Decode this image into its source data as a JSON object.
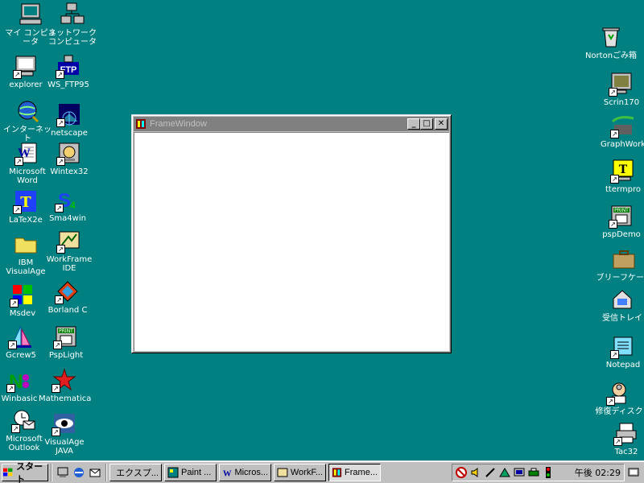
{
  "desktop": {
    "icons_left": [
      {
        "id": "my-computer",
        "label": "マイ コンピュータ",
        "icon": "computer-icon"
      },
      {
        "id": "network",
        "label": "ネットワーク\nコンピュータ",
        "icon": "network-icon"
      },
      {
        "id": "explorer",
        "label": "explorer",
        "icon": "explorer-icon"
      },
      {
        "id": "ws-ftp95",
        "label": "WS_FTP95",
        "icon": "ftp-icon"
      },
      {
        "id": "internet",
        "label": "インターネット",
        "icon": "internet-icon"
      },
      {
        "id": "netscape",
        "label": "netscape",
        "icon": "netscape-icon"
      },
      {
        "id": "word",
        "label": "Microsoft\nWord",
        "icon": "word-icon"
      },
      {
        "id": "wintex32",
        "label": "Wintex32",
        "icon": "wintex-icon"
      },
      {
        "id": "latex2e",
        "label": "LaTeX2e",
        "icon": "latex-icon"
      },
      {
        "id": "sma4win",
        "label": "Sma4win",
        "icon": "sma-icon"
      },
      {
        "id": "visualage",
        "label": "IBM\nVisualAge",
        "icon": "folder-icon"
      },
      {
        "id": "workframe",
        "label": "WorkFrame\nIDE",
        "icon": "workframe-icon"
      },
      {
        "id": "msdev",
        "label": "Msdev",
        "icon": "msdev-icon"
      },
      {
        "id": "borland",
        "label": "Borland C",
        "icon": "borland-icon"
      },
      {
        "id": "gcrew5",
        "label": "Gcrew5",
        "icon": "gcrew-icon"
      },
      {
        "id": "psplight",
        "label": "PspLight",
        "icon": "psp-icon"
      },
      {
        "id": "winbasic",
        "label": "Winbasic",
        "icon": "winbasic-icon"
      },
      {
        "id": "mathematica",
        "label": "Mathematica",
        "icon": "mathematica-icon"
      },
      {
        "id": "outlook",
        "label": "Microsoft\nOutlook",
        "icon": "outlook-icon"
      },
      {
        "id": "visualage-java",
        "label": "VisualAge\nJAVA",
        "icon": "eye-icon"
      }
    ],
    "icons_right": [
      {
        "id": "norton-trash",
        "label": "Nortonごみ箱",
        "icon": "recycle-bin-icon"
      },
      {
        "id": "scrin170",
        "label": "Scrin170",
        "icon": "monitor-icon"
      },
      {
        "id": "graphwork",
        "label": "GraphWork",
        "icon": "graph-icon"
      },
      {
        "id": "ttermpro",
        "label": "ttermpro",
        "icon": "terminal-icon"
      },
      {
        "id": "pspdemo",
        "label": "pspDemo",
        "icon": "psp-icon"
      },
      {
        "id": "briefcase",
        "label": "ブリーフケース",
        "icon": "briefcase-icon"
      },
      {
        "id": "inbox",
        "label": "受信トレイ",
        "icon": "inbox-icon"
      },
      {
        "id": "notepad",
        "label": "Notepad",
        "icon": "notepad-icon"
      },
      {
        "id": "repair-disk",
        "label": "修復ディスク",
        "icon": "doctor-icon"
      },
      {
        "id": "tac32",
        "label": "Tac32",
        "icon": "printer-icon"
      }
    ]
  },
  "window": {
    "title": "FrameWindow",
    "minimize": "_",
    "maximize": "□",
    "close": "✕"
  },
  "taskbar": {
    "start_label": "スタート",
    "tasks": [
      {
        "label": "エクスプ..."
      },
      {
        "label": "Paint ..."
      },
      {
        "label": "Micros..."
      },
      {
        "label": "WorkF..."
      },
      {
        "label": "Frame...",
        "active": true
      }
    ],
    "clock": "午後 02:29"
  },
  "colors": {
    "desktop": "#008080",
    "window_face": "#c0c0c0",
    "inactive_title": "#808080"
  }
}
